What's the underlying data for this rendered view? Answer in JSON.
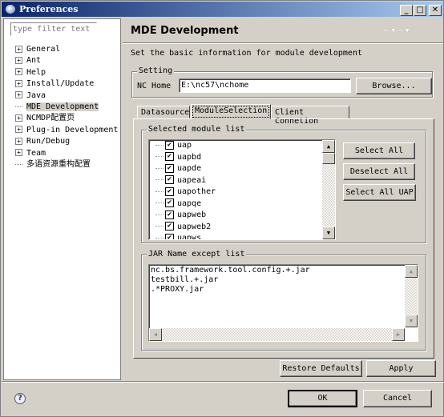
{
  "window": {
    "title": "Preferences",
    "minimize": "_",
    "maximize": "□",
    "close": "✕"
  },
  "sidebar": {
    "filter_placeholder": "type filter text",
    "items": [
      {
        "label": "General",
        "expandable": true
      },
      {
        "label": "Ant",
        "expandable": true
      },
      {
        "label": "Help",
        "expandable": true
      },
      {
        "label": "Install/Update",
        "expandable": true
      },
      {
        "label": "Java",
        "expandable": true
      },
      {
        "label": "MDE Development",
        "expandable": false,
        "selected": true
      },
      {
        "label": "NCMDP配置页",
        "expandable": true
      },
      {
        "label": "Plug-in Development",
        "expandable": true
      },
      {
        "label": "Run/Debug",
        "expandable": true
      },
      {
        "label": "Team",
        "expandable": true
      },
      {
        "label": "多语资源重构配置",
        "expandable": false
      }
    ]
  },
  "page": {
    "title": "MDE Development",
    "description": "Set the basic information for module development",
    "nav": {
      "back": "⇦",
      "back_menu": "▾",
      "forward": "⇨",
      "forward_menu": "▾"
    },
    "setting": {
      "label": "Setting",
      "nc_home_label": "NC Home",
      "nc_home_value": "E:\\nc57\\nchome",
      "browse": "Browse..."
    },
    "tabs": [
      {
        "label": "Datasource"
      },
      {
        "label": "ModuleSelection",
        "active": true
      },
      {
        "label": "Client Connetion"
      }
    ],
    "modules": {
      "label": "Selected module list",
      "items": [
        "uap",
        "uapbd",
        "uapde",
        "uapeai",
        "uapother",
        "uapqe",
        "uapweb",
        "uapweb2",
        "uapws"
      ],
      "select_all": "Select All",
      "deselect_all": "Deselect All",
      "select_all_uap": "Select All UAP"
    },
    "jar": {
      "label": "JAR Name except list",
      "lines": [
        "nc.bs.framework.tool.config.+.jar",
        "testbill.+.jar",
        ".*PROXY.jar"
      ]
    },
    "restore_defaults": "Restore Defaults",
    "apply": "Apply"
  },
  "footer": {
    "help": "?",
    "ok": "OK",
    "cancel": "Cancel"
  }
}
